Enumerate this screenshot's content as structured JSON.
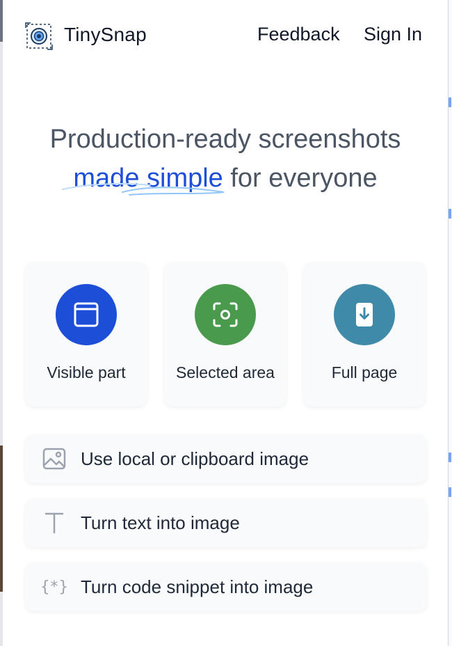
{
  "header": {
    "brand": "TinySnap",
    "feedback_label": "Feedback",
    "signin_label": "Sign In",
    "logo_icon": "tinysnap-logo-icon"
  },
  "hero": {
    "line1": "Production-ready screenshots",
    "accent": "made simple",
    "line2_rest": " for everyone"
  },
  "modes": [
    {
      "label": "Visible part",
      "icon": "browser-window-icon",
      "color": "#1d4ed8"
    },
    {
      "label": "Selected area",
      "icon": "focus-frame-icon",
      "color": "#4a9a4e"
    },
    {
      "label": "Full page",
      "icon": "page-download-icon",
      "color": "#3f8aa8"
    }
  ],
  "actions": [
    {
      "label": "Use local or clipboard image",
      "icon": "image-icon"
    },
    {
      "label": "Turn text into image",
      "icon": "text-icon"
    },
    {
      "label": "Turn code snippet into image",
      "icon": "code-braces-icon"
    }
  ],
  "colors": {
    "accent": "#1d4ed8",
    "card_bg": "#f8fafc",
    "text": "#1f2937",
    "muted": "#9ca3af"
  }
}
